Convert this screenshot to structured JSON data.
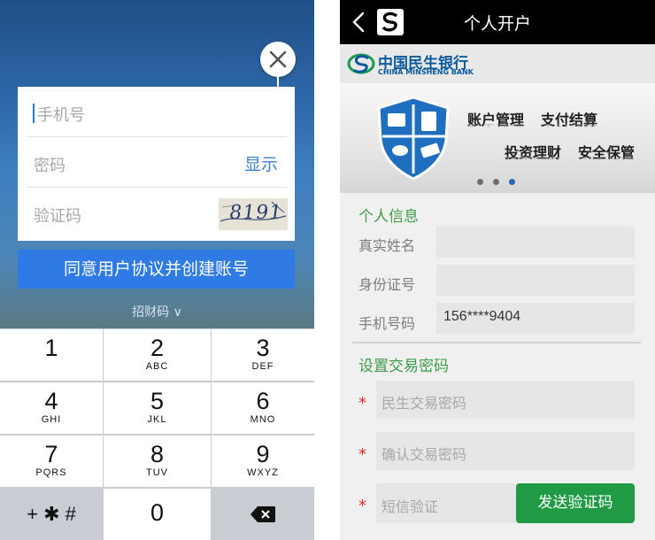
{
  "left": {
    "phone_placeholder": "手机号",
    "password_placeholder": "密码",
    "show_label": "显示",
    "captcha_placeholder": "验证码",
    "captcha_code": "8191",
    "create_button": "同意用户协议并创建账号",
    "invite_code": "招财码 ∨",
    "keys": [
      {
        "digit": "1",
        "letters": ""
      },
      {
        "digit": "2",
        "letters": "ABC"
      },
      {
        "digit": "3",
        "letters": "DEF"
      },
      {
        "digit": "4",
        "letters": "GHI"
      },
      {
        "digit": "5",
        "letters": "JKL"
      },
      {
        "digit": "6",
        "letters": "MNO"
      },
      {
        "digit": "7",
        "letters": "PQRS"
      },
      {
        "digit": "8",
        "letters": "TUV"
      },
      {
        "digit": "9",
        "letters": "WXYZ"
      },
      {
        "digit": "+ ✱ #",
        "letters": ""
      },
      {
        "digit": "0",
        "letters": ""
      },
      {
        "digit": "",
        "letters": ""
      }
    ],
    "accent_color": "#2f7ae5"
  },
  "right": {
    "header_title": "个人开户",
    "bank_name": "中国民生银行",
    "bank_name_en": "CHINA MINSHENG BANK",
    "banner": {
      "labels": [
        "账户管理",
        "支付结算",
        "投资理财",
        "安全保管"
      ],
      "active_slide": 3,
      "slides": 3
    },
    "personal_info_title": "个人信息",
    "fields": [
      {
        "label": "真实姓名",
        "value": ""
      },
      {
        "label": "身份证号",
        "value": ""
      },
      {
        "label": "手机号码",
        "value": "156****9404"
      }
    ],
    "password_title": "设置交易密码",
    "required_mark": "*",
    "password_placeholders": [
      "民生交易密码",
      "确认交易密码"
    ],
    "sms_placeholder": "短信验证",
    "send_code_button": "发送验证码",
    "accent_color": "#219a45"
  }
}
